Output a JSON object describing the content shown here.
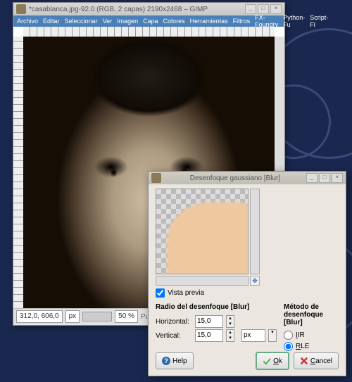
{
  "main": {
    "title": "*casablanca.jpg-92.0 (RGB, 2 capas) 2190x2468 – GIMP",
    "menu": [
      "Archivo",
      "Editar",
      "Seleccionar",
      "Ver",
      "Imagen",
      "Capa",
      "Colores",
      "Herramientas",
      "Filtros",
      "FX-Foundry",
      "Python-Fu",
      "Script-Fi"
    ],
    "status": {
      "coords": "312,0, 606,0",
      "unit": "px",
      "zoom": "50 %",
      "hint": "Pulse y arrastre para c"
    }
  },
  "dialog": {
    "title": "Desenfoque gaussiano [Blur]",
    "preview_label": "Vista previa",
    "radius_head": "Radio del desenfoque [Blur]",
    "h_label": "Horizontal:",
    "v_label": "Vertical:",
    "h_val": "15,0",
    "v_val": "15,0",
    "unit": "px",
    "method_head": "Método de desenfoque [Blur]",
    "opt_iir": "IIR",
    "opt_rle": "RLE",
    "help": "Help",
    "ok": "Ok",
    "cancel": "Cancel"
  }
}
